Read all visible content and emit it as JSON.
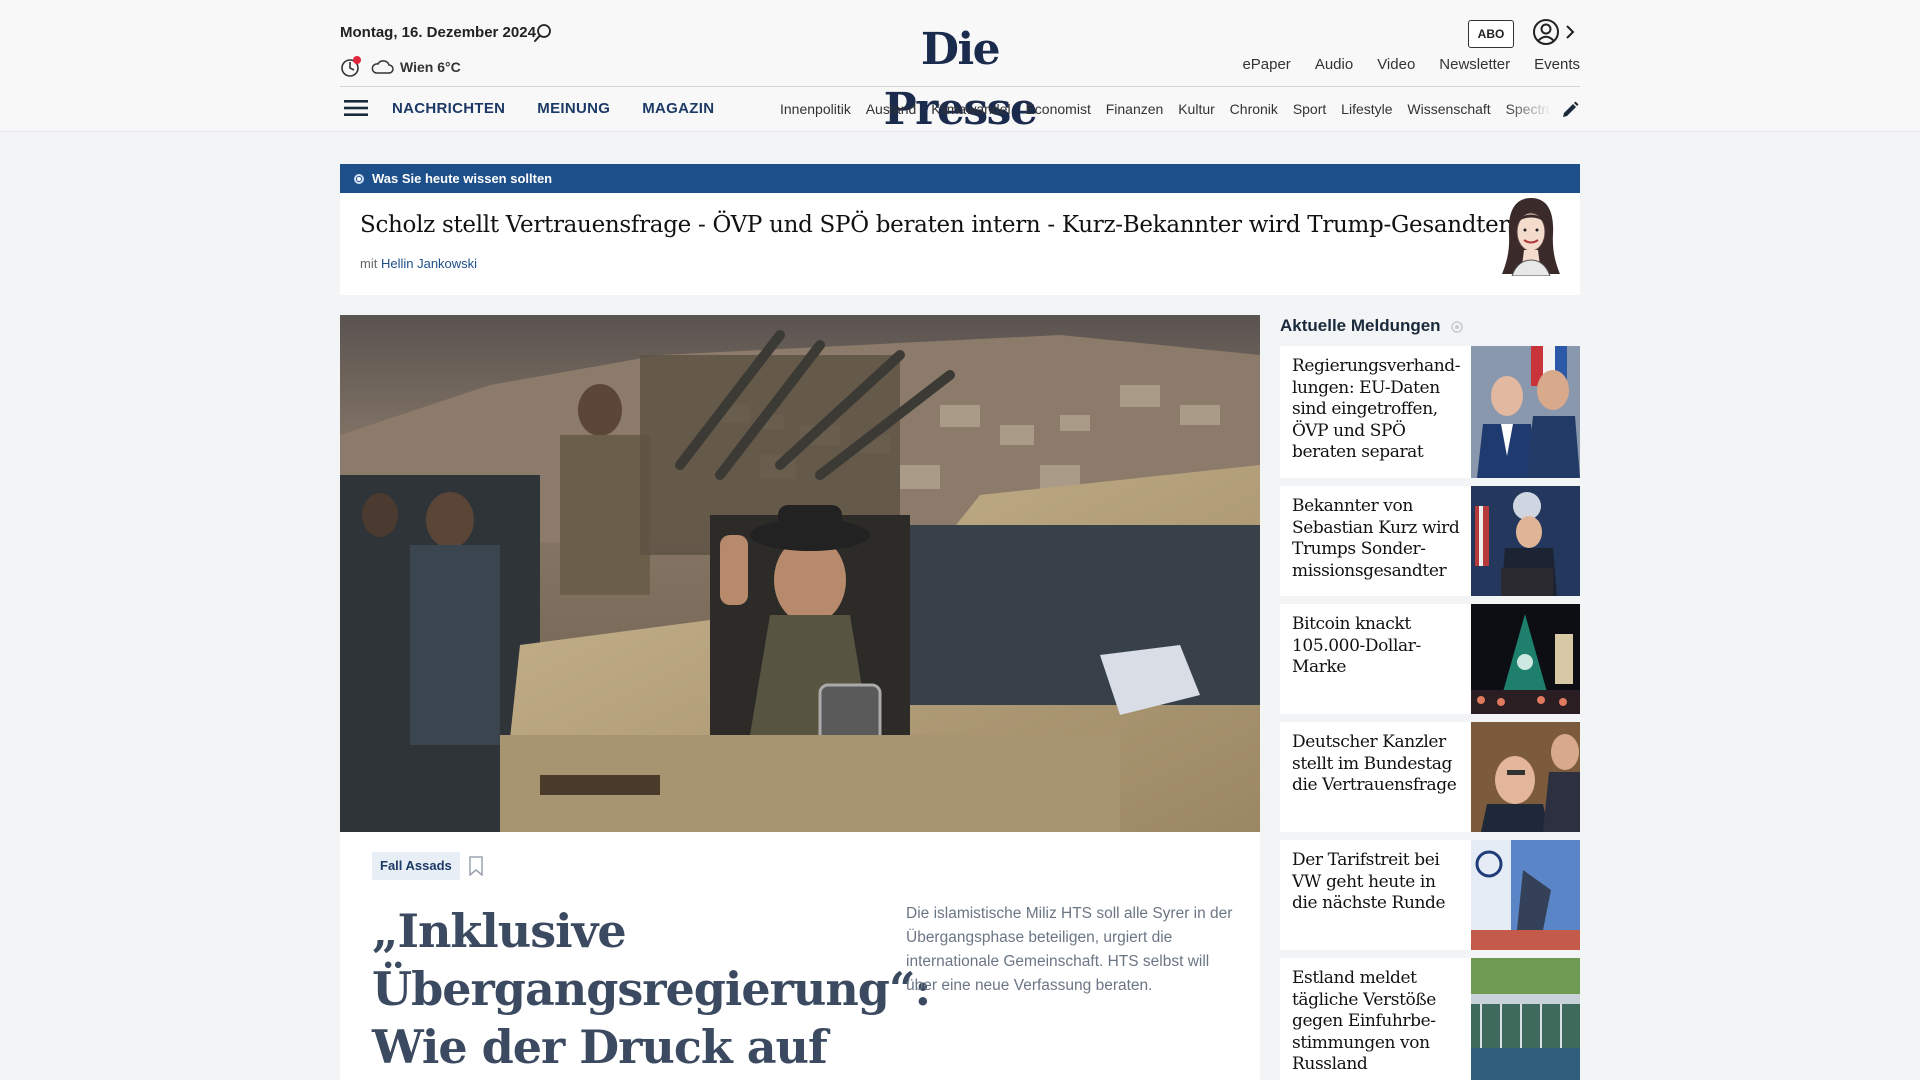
{
  "header": {
    "date": "Montag, 16. Dezember 2024",
    "weather": "Wien 6°C",
    "logo": "Die Presse",
    "abo_label": "ABO",
    "service_nav": [
      "ePaper",
      "Audio",
      "Video",
      "Newsletter",
      "Events"
    ],
    "main_nav": [
      "NACHRICHTEN",
      "MEINUNG",
      "MAGAZIN"
    ],
    "sub_nav": [
      "Innenpolitik",
      "Ausland",
      "Klimawandel",
      "Economist",
      "Finanzen",
      "Kultur",
      "Chronik",
      "Sport",
      "Lifestyle",
      "Wissenschaft",
      "Spectrum"
    ],
    "icons": [
      "search-icon",
      "moon-icon",
      "cloud-icon",
      "user-icon",
      "chevron-right-icon",
      "menu-icon",
      "pencil-icon"
    ]
  },
  "briefing": {
    "label": "Was Sie heute wissen sollten",
    "title": "Scholz stellt Vertrauensfrage - ÖVP und SPÖ beraten intern - Kurz-Bekannter wird Trump-Gesandter",
    "author_prefix": "mit",
    "author": "Hellin Jankowski"
  },
  "hero": {
    "tag": "Fall Assads",
    "headline": "„Inklusive Übergangsregierung“: Wie der Druck auf die",
    "teaser": "Die islamistische Miliz HTS soll alle Syrer in der Übergangsphase beteiligen, urgiert die internationale Gemeinschaft. HTS selbst will über eine neue Verfassung beraten."
  },
  "sidebar": {
    "title": "Aktuelle Meldungen",
    "items": [
      {
        "title": "Regierungsverhand­lungen: EU-Daten sind eingetroffen, ÖVP und SPÖ beraten separat"
      },
      {
        "title": "Bekannter von Sebastian Kurz wird Trumps Sonder­missionsgesandter"
      },
      {
        "title": "Bitcoin knackt 105.000-Dollar-Marke"
      },
      {
        "title": "Deutscher Kanzler stellt im Bundestag die Vertrauensfrage"
      },
      {
        "title": "Der Tarifstreit bei VW geht heute in die nächste Runde"
      },
      {
        "title": "Estland meldet tägliche Verstöße gegen Einfuhrbe­stimmungen von Russland"
      }
    ]
  },
  "colors": {
    "brand_navy": "#1b2b4d",
    "briefing_bar": "#1d4f8a",
    "live_dot": "#e0263a"
  }
}
